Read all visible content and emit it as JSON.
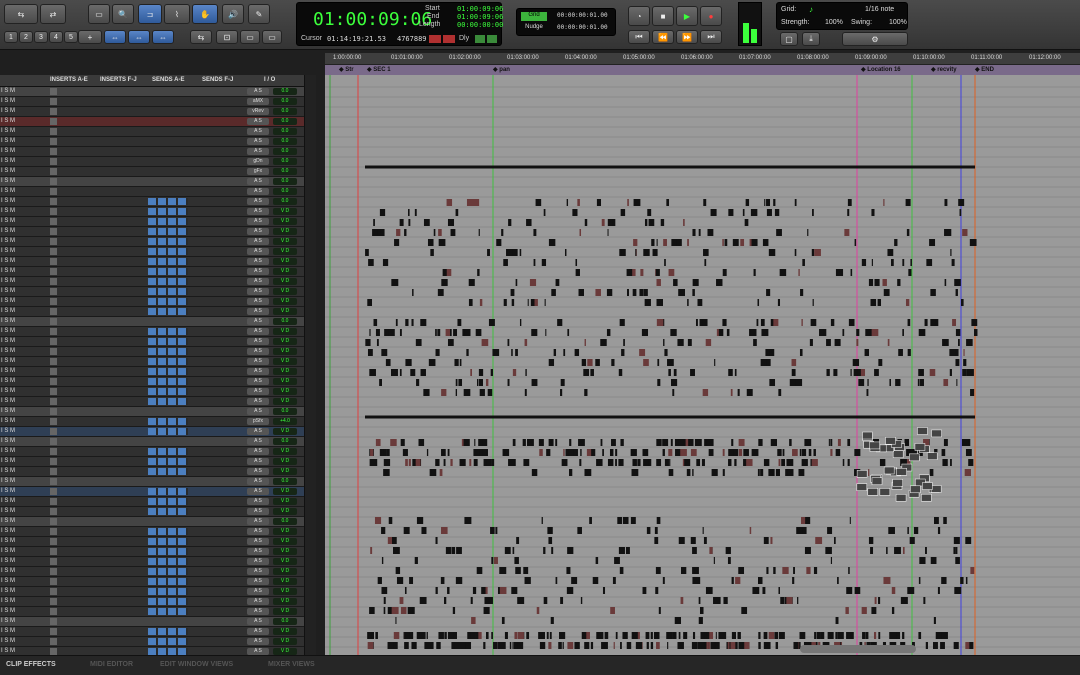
{
  "toolbar": {
    "counter_main": "01:00:09:06",
    "start_label": "Start",
    "end_label": "End",
    "length_label": "Length",
    "start_value": "01:00:09:06",
    "end_value": "01:00:09:06",
    "length_value": "00:00:00:00",
    "cursor_label": "Cursor",
    "cursor_value": "01:14:19:21.53",
    "sample_value": "4767889",
    "dly_label": "Dly",
    "grid_label": "Grid",
    "grid_value": "00:00:00:01.00",
    "nudge_label": "Nudge",
    "nudge_value": "00:00:00:01.00",
    "grid_note_label": "Grid:",
    "grid_note_value": "1/16 note",
    "strength_label": "Strength:",
    "strength_value": "100%",
    "swing_label": "Swing:",
    "swing_value": "100%",
    "zoom_presets": [
      "1",
      "2",
      "3",
      "4",
      "5"
    ]
  },
  "columns": {
    "inserts_ae": "INSERTS A-E",
    "inserts_fj": "INSERTS F-J",
    "sends_ae": "SENDS A-E",
    "sends_fj": "SENDS F-J",
    "io": "I / O"
  },
  "ruler": [
    "1:00:00:00",
    "01:01:00:00",
    "01:02:00:00",
    "01:03:00:00",
    "01:04:00:00",
    "01:05:00:00",
    "01:06:00:00",
    "01:07:00:00",
    "01:08:00:00",
    "01:09:00:00",
    "01:10:00:00",
    "01:11:00:00",
    "01:12:00:00"
  ],
  "markers": [
    "Str",
    "SEC 1",
    "pan",
    "Location 16",
    "recvity",
    "END"
  ],
  "track_io": {
    "master_1": "aMX",
    "master_2": "vRev",
    "aux_1": "gDn",
    "aux_2": "gFx",
    "aux_3": "pSfx"
  },
  "track_volume": "0.0",
  "track_volume_plus": "+4.0",
  "solo_mute": "I S M",
  "bottom": {
    "clip_effects": "CLIP EFFECTS",
    "tab2": "MIDI EDITOR",
    "tab3": "EDIT WINDOW VIEWS",
    "tab4": "MIXER VIEWS"
  },
  "colors": {
    "accent_blue": "#4c7fc0",
    "counter_green": "#3cff3c",
    "timeline_bg": "#9a9a9a",
    "marker_bar": "#7a6a8a"
  }
}
